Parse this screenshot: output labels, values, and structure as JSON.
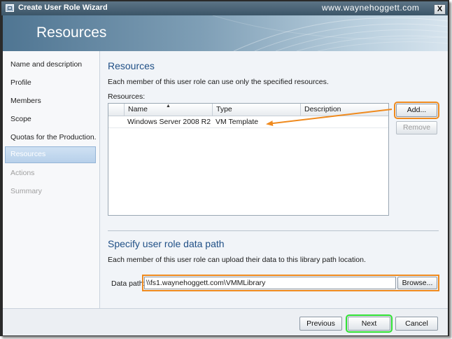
{
  "window": {
    "title": "Create User Role Wizard",
    "watermark": "www.waynehoggett.com",
    "close_glyph": "X",
    "app_icon": "wizard-window-icon",
    "close_icon": "close-x-icon"
  },
  "banner": {
    "title": "Resources"
  },
  "nav": {
    "items": [
      {
        "label": "Name and description",
        "state": "normal"
      },
      {
        "label": "Profile",
        "state": "normal"
      },
      {
        "label": "Members",
        "state": "normal"
      },
      {
        "label": "Scope",
        "state": "normal"
      },
      {
        "label": "Quotas for the Production...",
        "state": "normal"
      },
      {
        "label": "Resources",
        "state": "selected"
      },
      {
        "label": "Actions",
        "state": "disabled"
      },
      {
        "label": "Summary",
        "state": "disabled"
      }
    ]
  },
  "resources_section": {
    "heading": "Resources",
    "description": "Each member of this user role can use only the specified resources.",
    "list_label": "Resources:",
    "columns": [
      "Name",
      "Type",
      "Description"
    ],
    "sort_indicator": "▲",
    "rows": [
      {
        "name": "Windows Server 2008 R2",
        "type": "VM Template",
        "description": ""
      }
    ],
    "add_button": "Add...",
    "remove_button": "Remove"
  },
  "data_path_section": {
    "heading": "Specify user role data path",
    "description": "Each member of this user role can upload their data to this library path location.",
    "label": "Data path:",
    "value": "\\\\fs1.waynehoggett.com\\VMMLibrary",
    "browse_button": "Browse..."
  },
  "footer": {
    "previous": "Previous",
    "next": "Next",
    "cancel": "Cancel"
  },
  "colors": {
    "annotation_orange": "#ef8a1e",
    "annotation_green": "#2ee032",
    "heading_blue": "#1f4f86",
    "title_bar": "#3b5568"
  }
}
